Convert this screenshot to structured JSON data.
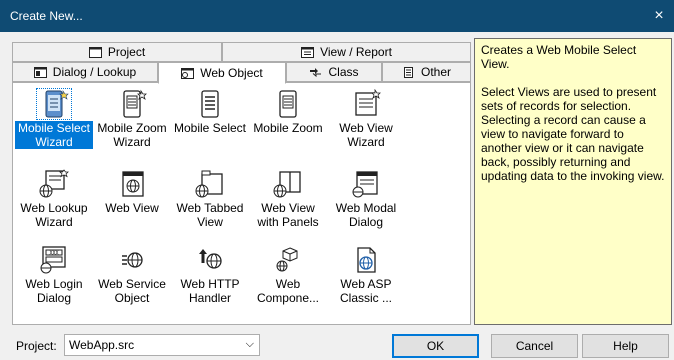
{
  "window": {
    "title": "Create New...",
    "close_glyph": "×"
  },
  "tabs_row1": [
    {
      "label": "Project",
      "icon": "project-window-icon"
    },
    {
      "label": "View / Report",
      "icon": "view-report-icon"
    }
  ],
  "tabs_row2": [
    {
      "label": "Dialog / Lookup",
      "icon": "dialog-lookup-icon"
    },
    {
      "label": "Web Object",
      "icon": "web-object-icon",
      "active": true
    },
    {
      "label": "Class",
      "icon": "class-icon"
    },
    {
      "label": "Other",
      "icon": "other-icon"
    }
  ],
  "items": [
    {
      "label": "Mobile Select Wizard",
      "icon": "mobile-select-wizard-icon",
      "selected": true
    },
    {
      "label": "Mobile Zoom Wizard",
      "icon": "mobile-zoom-wizard-icon"
    },
    {
      "label": "Mobile Select",
      "icon": "mobile-select-icon"
    },
    {
      "label": "Mobile Zoom",
      "icon": "mobile-zoom-icon"
    },
    {
      "label": "Web View Wizard",
      "icon": "web-view-wizard-icon"
    },
    {
      "label": "Web Lookup Wizard",
      "icon": "web-lookup-wizard-icon"
    },
    {
      "label": "Web View",
      "icon": "web-view-icon"
    },
    {
      "label": "Web Tabbed View",
      "icon": "web-tabbed-view-icon"
    },
    {
      "label": "Web View with Panels",
      "icon": "web-view-panels-icon"
    },
    {
      "label": "Web Modal Dialog",
      "icon": "web-modal-dialog-icon"
    },
    {
      "label": "Web Login Dialog",
      "icon": "web-login-dialog-icon"
    },
    {
      "label": "Web Service Object",
      "icon": "web-service-object-icon"
    },
    {
      "label": "Web HTTP Handler",
      "icon": "web-http-handler-icon"
    },
    {
      "label": "Web Compone...",
      "icon": "web-component-icon"
    },
    {
      "label": "Web ASP Classic ...",
      "icon": "web-asp-classic-icon"
    }
  ],
  "description": {
    "line1": "Creates a Web Mobile Select View.",
    "line2": "Select Views are used to present sets of records for selection. Selecting a record can cause a view to navigate forward to another view or it can navigate back, possibly returning and updating data to the invoking view."
  },
  "footer": {
    "project_label": "Project:",
    "project_value": "WebApp.src",
    "ok_label": "OK",
    "cancel_label": "Cancel",
    "help_label": "Help"
  },
  "colors": {
    "titlebar": "#0f4b73",
    "selection": "#0078d7",
    "description_bg": "#ffffc8"
  }
}
